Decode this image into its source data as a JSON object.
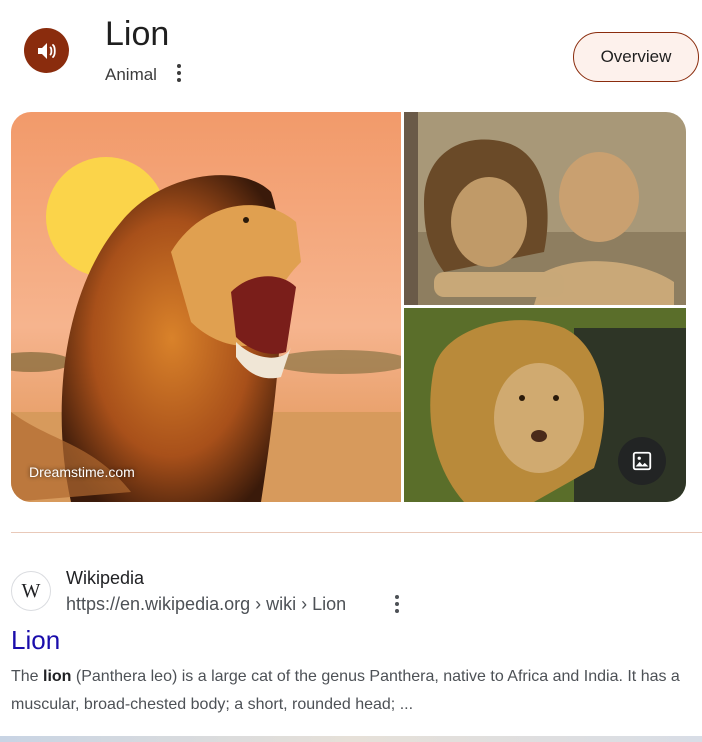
{
  "entity": {
    "title": "Lion",
    "subtitle": "Animal",
    "overview_label": "Overview",
    "audio_icon": "speaker-icon",
    "accent_color": "#8a2c0d"
  },
  "gallery": {
    "source_label": "Dreamstime.com",
    "images_icon": "image-icon"
  },
  "result": {
    "favicon_text": "W",
    "site_name": "Wikipedia",
    "url": "https://en.wikipedia.org › wiki › Lion",
    "title": "Lion",
    "snippet_pre": "The ",
    "snippet_bold": "lion",
    "snippet_post": " (Panthera leo) is a large cat of the genus Panthera, native to Africa and India. It has a muscular, broad-chested body; a short, rounded head; ...",
    "title_color": "#1a0dab"
  }
}
